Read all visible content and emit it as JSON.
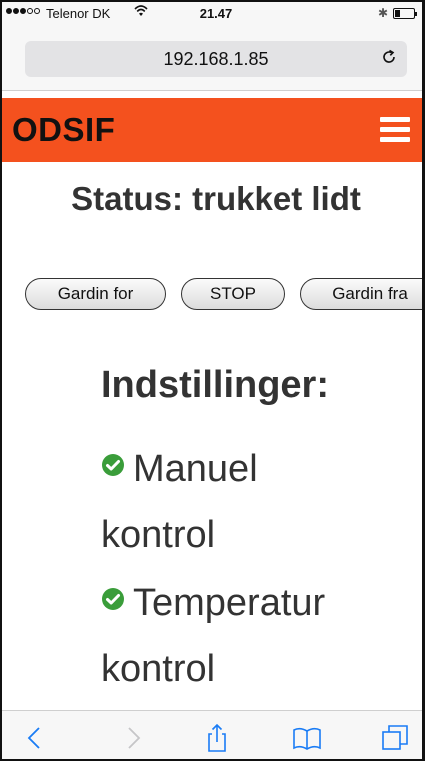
{
  "status_bar": {
    "carrier": "Telenor DK",
    "time": "21.47",
    "bluetooth_icon": "bluetooth-icon",
    "battery_level": 0.25
  },
  "browser": {
    "url": "192.168.1.85",
    "reload_icon": "reload-icon"
  },
  "header": {
    "brand": "ODSIF",
    "menu_icon": "hamburger-menu-icon"
  },
  "main": {
    "status_text": "Status: trukket lidt",
    "buttons": {
      "close_label": "Gardin for",
      "stop_label": "STOP",
      "open_label": "Gardin fra"
    },
    "settings": {
      "heading": "Indstillinger:",
      "items": [
        {
          "label_line1": "Manuel",
          "label_line2": "kontrol",
          "icon": "check-circle-icon"
        },
        {
          "label_line1": "Temperatur",
          "label_line2": "kontrol",
          "icon": "check-circle-icon"
        }
      ]
    }
  },
  "toolbar": {
    "icons": [
      "back-icon",
      "forward-icon",
      "share-icon",
      "bookmarks-icon",
      "tabs-icon"
    ]
  },
  "colors": {
    "header_bg": "#f4511e",
    "check_green": "#3a9d3a",
    "toolbar_icon": "#1a7cf5"
  }
}
